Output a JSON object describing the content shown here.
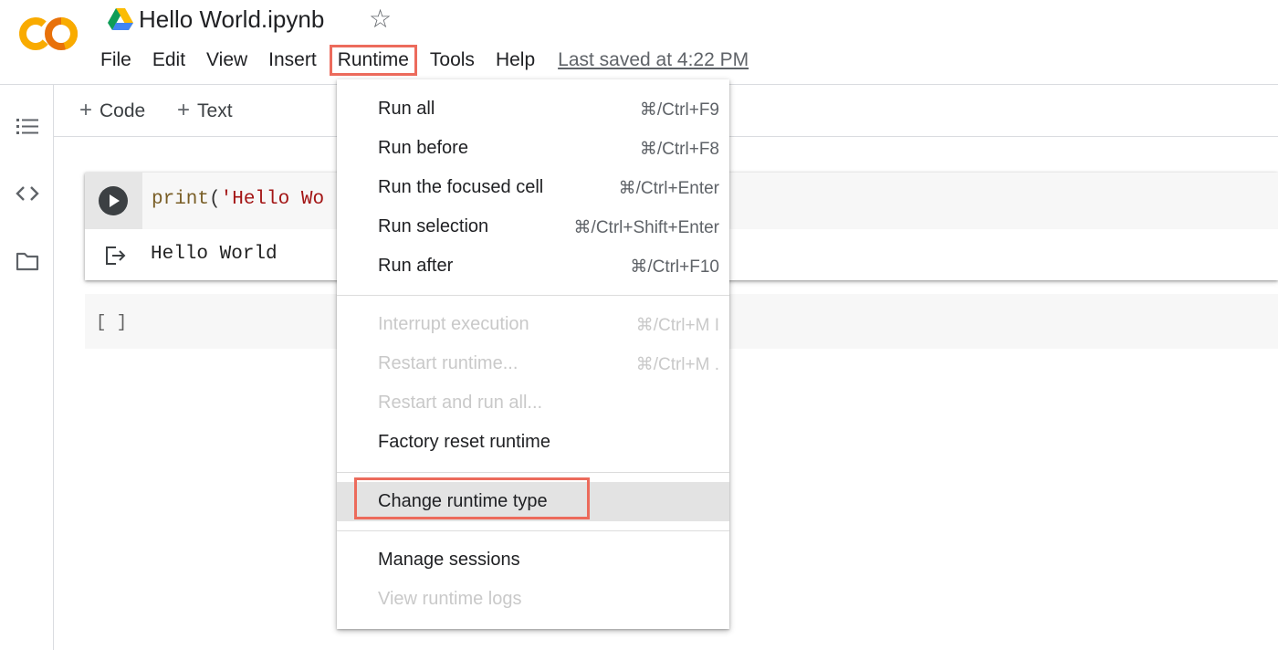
{
  "header": {
    "title": "Hello World.ipynb",
    "star_glyph": "☆",
    "menu": [
      "File",
      "Edit",
      "View",
      "Insert",
      "Runtime",
      "Tools",
      "Help"
    ],
    "last_saved": "Last saved at 4:22 PM"
  },
  "toolbar": {
    "code_label": "Code",
    "text_label": "Text",
    "plus_glyph": "+"
  },
  "cells": {
    "cell1_code": {
      "fn": "print",
      "open": "(",
      "str": "'Hello Wo"
    },
    "cell1_output": "Hello World",
    "cell2_prompt": "[ ]"
  },
  "runtime_menu": {
    "items": [
      {
        "label": "Run all",
        "shortcut": "⌘/Ctrl+F9"
      },
      {
        "label": "Run before",
        "shortcut": "⌘/Ctrl+F8"
      },
      {
        "label": "Run the focused cell",
        "shortcut": "⌘/Ctrl+Enter"
      },
      {
        "label": "Run selection",
        "shortcut": "⌘/Ctrl+Shift+Enter"
      },
      {
        "label": "Run after",
        "shortcut": "⌘/Ctrl+F10"
      },
      {
        "label": "Interrupt execution",
        "shortcut": "⌘/Ctrl+M I"
      },
      {
        "label": "Restart runtime...",
        "shortcut": "⌘/Ctrl+M ."
      },
      {
        "label": "Restart and run all..."
      },
      {
        "label": "Factory reset runtime"
      },
      {
        "label": "Change runtime type"
      },
      {
        "label": "Manage sessions"
      },
      {
        "label": "View runtime logs"
      }
    ]
  },
  "colors": {
    "highlight_border": "#ec6b5c",
    "logo_orange": "#f9ab00",
    "logo_dark_orange": "#e8710a",
    "disabled_text": "#c9c9c9"
  },
  "icons": {
    "logo": "colab-logo",
    "drive": "google-drive-icon",
    "star": "star-icon",
    "toc": "table-of-contents-icon",
    "code": "code-snippets-icon",
    "files": "folder-icon",
    "run": "play-icon",
    "output": "output-arrow-icon"
  }
}
